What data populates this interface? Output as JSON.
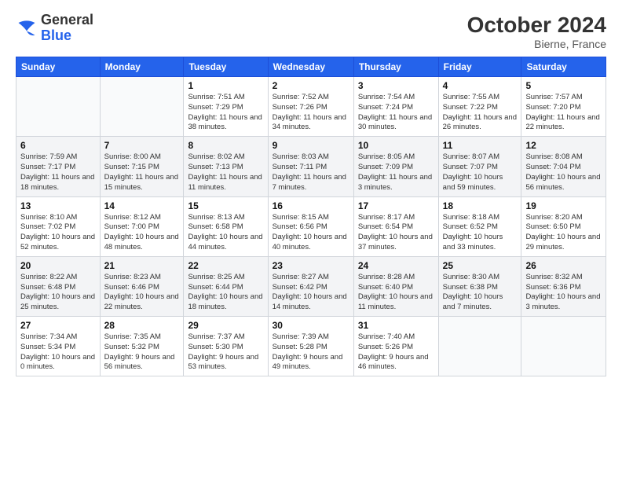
{
  "header": {
    "logo_line1": "General",
    "logo_line2": "Blue",
    "month_year": "October 2024",
    "location": "Bierne, France"
  },
  "weekdays": [
    "Sunday",
    "Monday",
    "Tuesday",
    "Wednesday",
    "Thursday",
    "Friday",
    "Saturday"
  ],
  "weeks": [
    [
      {
        "day": "",
        "info": ""
      },
      {
        "day": "",
        "info": ""
      },
      {
        "day": "1",
        "info": "Sunrise: 7:51 AM\nSunset: 7:29 PM\nDaylight: 11 hours\nand 38 minutes."
      },
      {
        "day": "2",
        "info": "Sunrise: 7:52 AM\nSunset: 7:26 PM\nDaylight: 11 hours\nand 34 minutes."
      },
      {
        "day": "3",
        "info": "Sunrise: 7:54 AM\nSunset: 7:24 PM\nDaylight: 11 hours\nand 30 minutes."
      },
      {
        "day": "4",
        "info": "Sunrise: 7:55 AM\nSunset: 7:22 PM\nDaylight: 11 hours\nand 26 minutes."
      },
      {
        "day": "5",
        "info": "Sunrise: 7:57 AM\nSunset: 7:20 PM\nDaylight: 11 hours\nand 22 minutes."
      }
    ],
    [
      {
        "day": "6",
        "info": "Sunrise: 7:59 AM\nSunset: 7:17 PM\nDaylight: 11 hours\nand 18 minutes."
      },
      {
        "day": "7",
        "info": "Sunrise: 8:00 AM\nSunset: 7:15 PM\nDaylight: 11 hours\nand 15 minutes."
      },
      {
        "day": "8",
        "info": "Sunrise: 8:02 AM\nSunset: 7:13 PM\nDaylight: 11 hours\nand 11 minutes."
      },
      {
        "day": "9",
        "info": "Sunrise: 8:03 AM\nSunset: 7:11 PM\nDaylight: 11 hours\nand 7 minutes."
      },
      {
        "day": "10",
        "info": "Sunrise: 8:05 AM\nSunset: 7:09 PM\nDaylight: 11 hours\nand 3 minutes."
      },
      {
        "day": "11",
        "info": "Sunrise: 8:07 AM\nSunset: 7:07 PM\nDaylight: 10 hours\nand 59 minutes."
      },
      {
        "day": "12",
        "info": "Sunrise: 8:08 AM\nSunset: 7:04 PM\nDaylight: 10 hours\nand 56 minutes."
      }
    ],
    [
      {
        "day": "13",
        "info": "Sunrise: 8:10 AM\nSunset: 7:02 PM\nDaylight: 10 hours\nand 52 minutes."
      },
      {
        "day": "14",
        "info": "Sunrise: 8:12 AM\nSunset: 7:00 PM\nDaylight: 10 hours\nand 48 minutes."
      },
      {
        "day": "15",
        "info": "Sunrise: 8:13 AM\nSunset: 6:58 PM\nDaylight: 10 hours\nand 44 minutes."
      },
      {
        "day": "16",
        "info": "Sunrise: 8:15 AM\nSunset: 6:56 PM\nDaylight: 10 hours\nand 40 minutes."
      },
      {
        "day": "17",
        "info": "Sunrise: 8:17 AM\nSunset: 6:54 PM\nDaylight: 10 hours\nand 37 minutes."
      },
      {
        "day": "18",
        "info": "Sunrise: 8:18 AM\nSunset: 6:52 PM\nDaylight: 10 hours\nand 33 minutes."
      },
      {
        "day": "19",
        "info": "Sunrise: 8:20 AM\nSunset: 6:50 PM\nDaylight: 10 hours\nand 29 minutes."
      }
    ],
    [
      {
        "day": "20",
        "info": "Sunrise: 8:22 AM\nSunset: 6:48 PM\nDaylight: 10 hours\nand 25 minutes."
      },
      {
        "day": "21",
        "info": "Sunrise: 8:23 AM\nSunset: 6:46 PM\nDaylight: 10 hours\nand 22 minutes."
      },
      {
        "day": "22",
        "info": "Sunrise: 8:25 AM\nSunset: 6:44 PM\nDaylight: 10 hours\nand 18 minutes."
      },
      {
        "day": "23",
        "info": "Sunrise: 8:27 AM\nSunset: 6:42 PM\nDaylight: 10 hours\nand 14 minutes."
      },
      {
        "day": "24",
        "info": "Sunrise: 8:28 AM\nSunset: 6:40 PM\nDaylight: 10 hours\nand 11 minutes."
      },
      {
        "day": "25",
        "info": "Sunrise: 8:30 AM\nSunset: 6:38 PM\nDaylight: 10 hours\nand 7 minutes."
      },
      {
        "day": "26",
        "info": "Sunrise: 8:32 AM\nSunset: 6:36 PM\nDaylight: 10 hours\nand 3 minutes."
      }
    ],
    [
      {
        "day": "27",
        "info": "Sunrise: 7:34 AM\nSunset: 5:34 PM\nDaylight: 10 hours\nand 0 minutes."
      },
      {
        "day": "28",
        "info": "Sunrise: 7:35 AM\nSunset: 5:32 PM\nDaylight: 9 hours\nand 56 minutes."
      },
      {
        "day": "29",
        "info": "Sunrise: 7:37 AM\nSunset: 5:30 PM\nDaylight: 9 hours\nand 53 minutes."
      },
      {
        "day": "30",
        "info": "Sunrise: 7:39 AM\nSunset: 5:28 PM\nDaylight: 9 hours\nand 49 minutes."
      },
      {
        "day": "31",
        "info": "Sunrise: 7:40 AM\nSunset: 5:26 PM\nDaylight: 9 hours\nand 46 minutes."
      },
      {
        "day": "",
        "info": ""
      },
      {
        "day": "",
        "info": ""
      }
    ]
  ]
}
